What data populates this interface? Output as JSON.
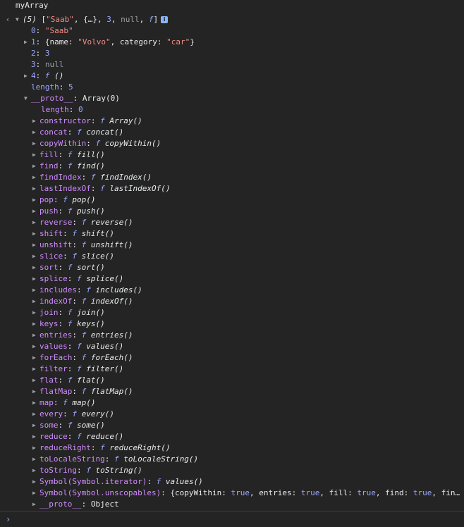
{
  "command": "myArray",
  "summary": {
    "count": "(5)",
    "open": "[",
    "items": [
      "\"Saab\"",
      ", {…}, ",
      "3",
      ", ",
      "null",
      ", ",
      "f"
    ],
    "close": "]",
    "info_glyph": "i"
  },
  "entries": [
    {
      "key": "0",
      "value": "\"Saab\"",
      "type": "string"
    },
    {
      "key": "1",
      "value_parts": [
        "{name: ",
        "\"Volvo\"",
        ", category: ",
        "\"car\"",
        "}"
      ],
      "type": "object"
    },
    {
      "key": "2",
      "value": "3",
      "type": "number"
    },
    {
      "key": "3",
      "value": "null",
      "type": "null"
    },
    {
      "key": "4",
      "f": "f",
      "value": "()",
      "type": "function"
    }
  ],
  "length_label": "length",
  "length_value": "5",
  "proto": {
    "label": "__proto__",
    "value": "Array(0)",
    "length_label": "length",
    "length_value": "0",
    "methods": [
      {
        "key": "constructor",
        "fname": "Array()"
      },
      {
        "key": "concat",
        "fname": "concat()"
      },
      {
        "key": "copyWithin",
        "fname": "copyWithin()"
      },
      {
        "key": "fill",
        "fname": "fill()"
      },
      {
        "key": "find",
        "fname": "find()"
      },
      {
        "key": "findIndex",
        "fname": "findIndex()"
      },
      {
        "key": "lastIndexOf",
        "fname": "lastIndexOf()"
      },
      {
        "key": "pop",
        "fname": "pop()"
      },
      {
        "key": "push",
        "fname": "push()"
      },
      {
        "key": "reverse",
        "fname": "reverse()"
      },
      {
        "key": "shift",
        "fname": "shift()"
      },
      {
        "key": "unshift",
        "fname": "unshift()"
      },
      {
        "key": "slice",
        "fname": "slice()"
      },
      {
        "key": "sort",
        "fname": "sort()"
      },
      {
        "key": "splice",
        "fname": "splice()"
      },
      {
        "key": "includes",
        "fname": "includes()"
      },
      {
        "key": "indexOf",
        "fname": "indexOf()"
      },
      {
        "key": "join",
        "fname": "join()"
      },
      {
        "key": "keys",
        "fname": "keys()"
      },
      {
        "key": "entries",
        "fname": "entries()"
      },
      {
        "key": "values",
        "fname": "values()"
      },
      {
        "key": "forEach",
        "fname": "forEach()"
      },
      {
        "key": "filter",
        "fname": "filter()"
      },
      {
        "key": "flat",
        "fname": "flat()"
      },
      {
        "key": "flatMap",
        "fname": "flatMap()"
      },
      {
        "key": "map",
        "fname": "map()"
      },
      {
        "key": "every",
        "fname": "every()"
      },
      {
        "key": "some",
        "fname": "some()"
      },
      {
        "key": "reduce",
        "fname": "reduce()"
      },
      {
        "key": "reduceRight",
        "fname": "reduceRight()"
      },
      {
        "key": "toLocaleString",
        "fname": "toLocaleString()"
      },
      {
        "key": "toString",
        "fname": "toString()"
      },
      {
        "key": "Symbol(Symbol.iterator)",
        "fname": "values()"
      }
    ],
    "unscopables": {
      "key": "Symbol(Symbol.unscopables)",
      "parts": [
        "{copyWithin: ",
        "true",
        ", entries: ",
        "true",
        ", fill: ",
        "true",
        ", find: ",
        "true",
        ", fin…"
      ]
    },
    "inner_proto": {
      "label": "__proto__",
      "value": "Object"
    }
  },
  "fn_glyph": "f",
  "prompt_glyph": "›",
  "colors": {
    "background": "#242424",
    "key": "#9aa8ff",
    "string": "#f28b82",
    "proto_key": "#d18cff"
  }
}
